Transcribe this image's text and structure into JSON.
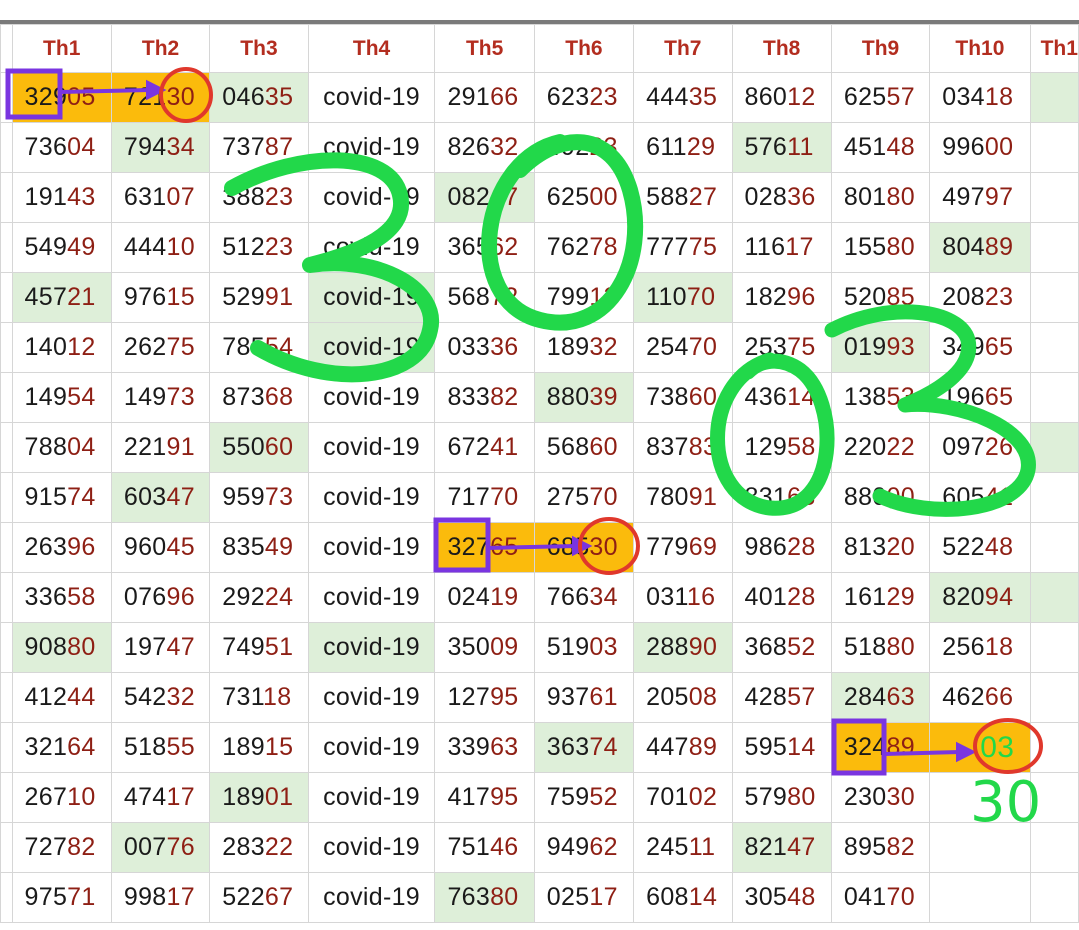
{
  "columns": [
    "",
    "Th1",
    "Th2",
    "Th3",
    "Th4",
    "Th5",
    "Th6",
    "Th7",
    "Th8",
    "Th9",
    "Th10",
    "Th1"
  ],
  "rows": [
    [
      "32905",
      "72130",
      "04635",
      "covid-19",
      "29166",
      "62323",
      "44435",
      "86012",
      "62557",
      "03418",
      ""
    ],
    [
      "73604",
      "79434",
      "73787",
      "covid-19",
      "82632",
      "49223",
      "61129",
      "57611",
      "45148",
      "99600",
      ""
    ],
    [
      "19143",
      "63107",
      "38823",
      "covid-19",
      "08247",
      "62500",
      "58827",
      "02836",
      "80180",
      "49797",
      ""
    ],
    [
      "54949",
      "44410",
      "51223",
      "covid-19",
      "36562",
      "76278",
      "77775",
      "11617",
      "15580",
      "80489",
      ""
    ],
    [
      "45721",
      "97615",
      "52991",
      "covid-19",
      "56872",
      "79913",
      "11070",
      "18296",
      "52085",
      "20823",
      ""
    ],
    [
      "14012",
      "26275",
      "78554",
      "covid-19",
      "03336",
      "18932",
      "25470",
      "25375",
      "01993",
      "34965",
      ""
    ],
    [
      "14954",
      "14973",
      "87368",
      "covid-19",
      "83382",
      "88039",
      "73860",
      "43614",
      "13853",
      "19665",
      ""
    ],
    [
      "78804",
      "22191",
      "55060",
      "covid-19",
      "67241",
      "56860",
      "83783",
      "12958",
      "22022",
      "09726",
      ""
    ],
    [
      "91574",
      "60347",
      "95973",
      "covid-19",
      "71770",
      "27570",
      "78091",
      "83168",
      "88000",
      "60541",
      ""
    ],
    [
      "26396",
      "96045",
      "83549",
      "covid-19",
      "32765",
      "68530",
      "77969",
      "98628",
      "81320",
      "52248",
      ""
    ],
    [
      "33658",
      "07696",
      "29224",
      "covid-19",
      "02419",
      "76634",
      "03116",
      "40128",
      "16129",
      "82094",
      ""
    ],
    [
      "90880",
      "19747",
      "74951",
      "covid-19",
      "35009",
      "51903",
      "28890",
      "36852",
      "51880",
      "25618",
      ""
    ],
    [
      "41244",
      "54232",
      "73118",
      "covid-19",
      "12795",
      "93761",
      "20508",
      "42857",
      "28463",
      "46266",
      ""
    ],
    [
      "32164",
      "51855",
      "18915",
      "covid-19",
      "33963",
      "36374",
      "44789",
      "59514",
      "32489",
      "03",
      ""
    ],
    [
      "26710",
      "47417",
      "18901",
      "covid-19",
      "41795",
      "75952",
      "70102",
      "57980",
      "23030",
      "",
      ""
    ],
    [
      "72782",
      "00776",
      "28322",
      "covid-19",
      "75146",
      "94962",
      "24511",
      "82147",
      "89582",
      "",
      ""
    ],
    [
      "97571",
      "99817",
      "52267",
      "covid-19",
      "76380",
      "02517",
      "60814",
      "30548",
      "04170",
      "",
      ""
    ]
  ],
  "green_cells": [
    [
      0,
      2
    ],
    [
      0,
      10
    ],
    [
      1,
      1
    ],
    [
      1,
      7
    ],
    [
      2,
      4
    ],
    [
      3,
      9
    ],
    [
      4,
      0
    ],
    [
      4,
      3
    ],
    [
      4,
      6
    ],
    [
      5,
      3
    ],
    [
      5,
      8
    ],
    [
      6,
      5
    ],
    [
      7,
      2
    ],
    [
      7,
      10
    ],
    [
      8,
      1
    ],
    [
      10,
      9
    ],
    [
      10,
      10
    ],
    [
      11,
      0
    ],
    [
      11,
      3
    ],
    [
      11,
      6
    ],
    [
      12,
      8
    ],
    [
      13,
      5
    ],
    [
      14,
      2
    ],
    [
      15,
      1
    ],
    [
      15,
      7
    ],
    [
      16,
      4
    ]
  ],
  "orange_cells": [
    [
      0,
      0
    ],
    [
      0,
      1
    ],
    [
      9,
      4
    ],
    [
      9,
      5
    ],
    [
      13,
      8
    ],
    [
      13,
      9
    ]
  ],
  "annotation_text": "30",
  "colors": {
    "header_text": "#b32d1f",
    "digit_tail": "#8e1f14",
    "green_fill": "#deefd9",
    "orange_fill": "#fbbb0c",
    "ink_green": "#22d84a",
    "ink_red": "#e0382c",
    "ink_purple": "#7a35e0"
  }
}
